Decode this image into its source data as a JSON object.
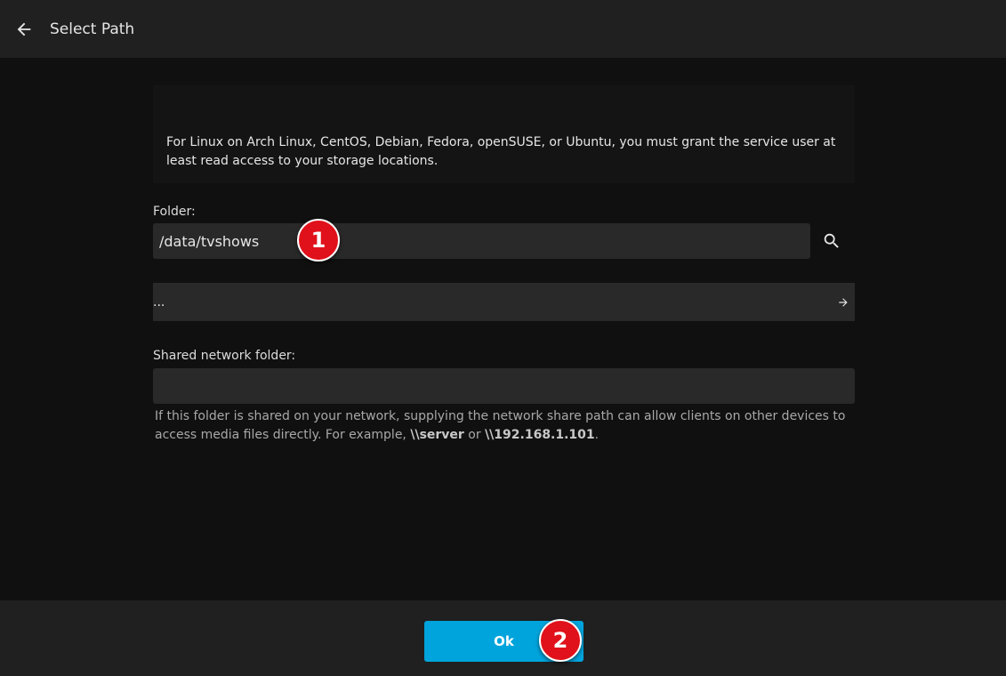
{
  "header": {
    "title": "Select Path"
  },
  "notice": {
    "text": "For Linux on Arch Linux, CentOS, Debian, Fedora, openSUSE, or Ubuntu, you must grant the service user at least read access to your storage locations."
  },
  "folder": {
    "label": "Folder:",
    "value": "/data/tvshows"
  },
  "directory_list": {
    "items": [
      {
        "label": "..."
      }
    ]
  },
  "share": {
    "label": "Shared network folder:",
    "value": "",
    "help_prefix": "If this folder is shared on your network, supplying the network share path can allow clients on other devices to access media files directly. For example, ",
    "example1": "\\\\server",
    "help_middle": " or ",
    "example2": "\\\\192.168.1.101",
    "help_suffix": "."
  },
  "footer": {
    "ok_label": "Ok"
  },
  "annotations": [
    {
      "number": "1"
    },
    {
      "number": "2"
    }
  ],
  "colors": {
    "accent": "#00a4dc",
    "badge": "#e0111a",
    "header_bg": "#202020",
    "page_bg": "#101010"
  }
}
